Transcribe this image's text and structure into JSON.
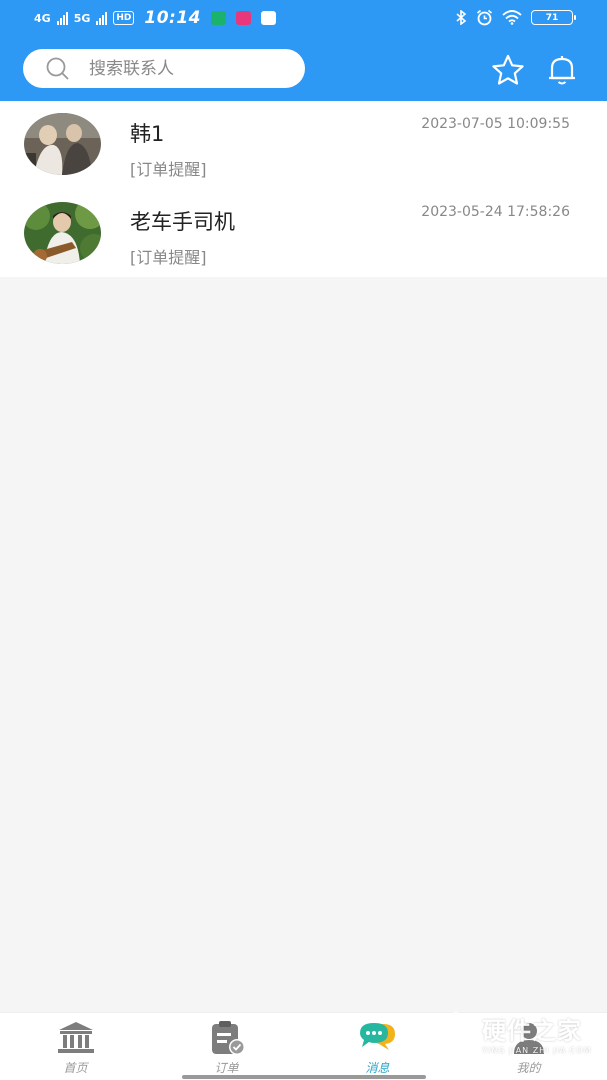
{
  "status_bar": {
    "net1": "4G",
    "net2": "5G",
    "hd": "HD",
    "time": "10:14",
    "battery": "71"
  },
  "search": {
    "placeholder": "搜索联系人"
  },
  "conversations": [
    {
      "name": "韩1",
      "time": "2023-07-05 10:09:55",
      "preview": "[订单提醒]"
    },
    {
      "name": "老车手司机",
      "time": "2023-05-24 17:58:26",
      "preview": "[订单提醒]"
    }
  ],
  "tabs": [
    {
      "label": "首页",
      "icon": "bank-icon",
      "active": false
    },
    {
      "label": "订单",
      "icon": "order-clipboard-icon",
      "active": false
    },
    {
      "label": "消息",
      "icon": "chat-bubbles-icon",
      "active": true
    },
    {
      "label": "我的",
      "icon": "person-icon",
      "active": false
    }
  ],
  "watermark": {
    "title": "硬件之家",
    "subtitle": "YING JIAN ZHI JIA.COM"
  },
  "colors": {
    "header": "#2e98f5",
    "active_tab": "#2aa5c8",
    "background": "#f5f5f5"
  }
}
